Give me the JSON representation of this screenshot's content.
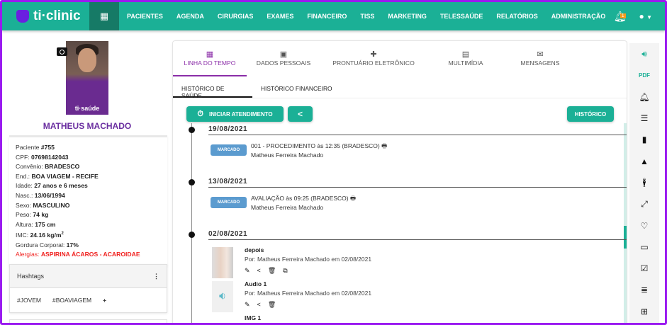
{
  "app": {
    "logo": "ti·clinic"
  },
  "nav": {
    "items": [
      "PACIENTES",
      "AGENDA",
      "CIRURGIAS",
      "EXAMES",
      "FINANCEIRO",
      "TISS",
      "MARKETING",
      "TELESSAÚDE",
      "RELATÓRIOS",
      "ADMINISTRAÇÃO"
    ],
    "notification_count": "1"
  },
  "patient": {
    "name": "MATHEUS MACHADO",
    "photo_brand": "ti·saúde",
    "fields": [
      {
        "label": "Paciente ",
        "value": "#755"
      },
      {
        "label": "CPF: ",
        "value": "07698142043"
      },
      {
        "label": "Convênio: ",
        "value": "BRADESCO"
      },
      {
        "label": "End.: ",
        "value": "BOA VIAGEM - RECIFE"
      },
      {
        "label": "Idade: ",
        "value": "27 anos e 6 meses"
      },
      {
        "label": "Nasc.: ",
        "value": "13/06/1994"
      },
      {
        "label": "Sexo: ",
        "value": "MASCULINO"
      },
      {
        "label": "Peso: ",
        "value": "74 kg"
      },
      {
        "label": "Altura: ",
        "value": "175 cm"
      },
      {
        "label": "IMC: ",
        "value": "24.16 kg/m",
        "sup": "2"
      },
      {
        "label": "Gordura Corporal: ",
        "value": "17%"
      },
      {
        "label": "Alergias: ",
        "value": "ASPIRINA ÁCAROS - ACAROIDAE"
      }
    ]
  },
  "hashtags": {
    "title": "Hashtags",
    "items": [
      "#JOVEM",
      "#BOAVIAGEM"
    ],
    "add": "+"
  },
  "tabs": [
    "LINHA DO TEMPO",
    "DADOS PESSOAIS",
    "PRONTUÁRIO ELETRÔNICO",
    "MULTIMÍDIA",
    "MENSAGENS"
  ],
  "subtabs": [
    "HISTÓRICO DE SAÚDE",
    "HISTÓRICO FINANCEIRO"
  ],
  "buttons": {
    "start": "INICIAR ATENDIMENTO",
    "history": "HISTÓRICO"
  },
  "timeline": [
    {
      "date": "19/08/2021",
      "status": "MARCADO",
      "title": "001 - PROCEDIMENTO às 12:35 (BRADESCO)",
      "doctor": "Matheus Ferreira Machado"
    },
    {
      "date": "13/08/2021",
      "status": "MARCADO",
      "title": "AVALIAÇÃO às 09:25 (BRADESCO)",
      "doctor": "Matheus Ferreira Machado"
    },
    {
      "date": "02/08/2021",
      "media": [
        {
          "title": "depois",
          "by": "Por: Matheus Ferreira Machado em 02/08/2021"
        },
        {
          "title": "Audio 1",
          "by": "Por: Matheus Ferreira Machado em 02/08/2021"
        },
        {
          "title": "IMG 1"
        }
      ]
    }
  ],
  "colors": {
    "primary": "#1bb096",
    "accent": "#8b2ea8",
    "alert": "#f0201e",
    "tag": "#5b9bcf"
  }
}
